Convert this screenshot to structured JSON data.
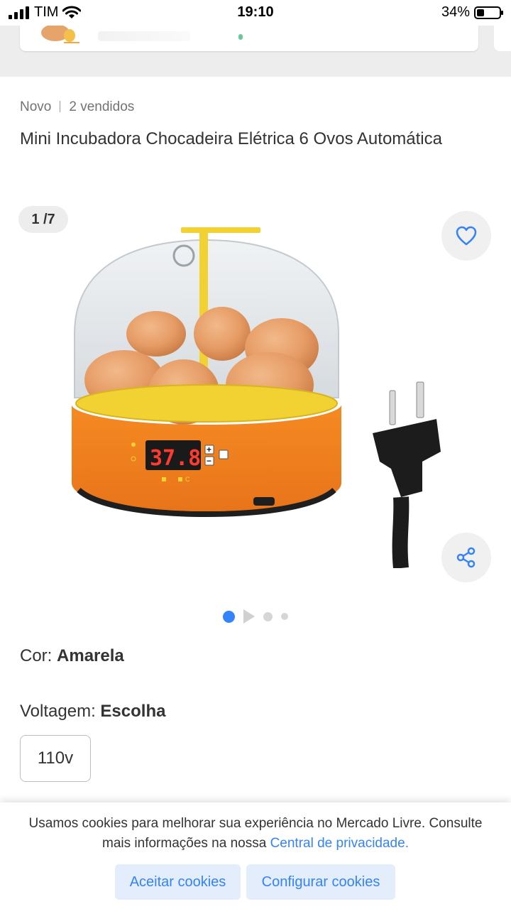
{
  "status_bar": {
    "carrier": "TIM",
    "time": "19:10",
    "battery_text": "34%",
    "battery_level": 0.34,
    "icons": [
      "signal-icon",
      "wifi-icon",
      "battery-icon"
    ]
  },
  "listing": {
    "condition": "Novo",
    "sold": "2 vendidos",
    "title": "Mini Incubadora Chocadeira Elétrica 6 Ovos Automática"
  },
  "gallery": {
    "counter": "1 /7",
    "display_temp": "37.8",
    "display_unit_c": "C",
    "current_index": 1,
    "total_images": 7,
    "icons": [
      "heart-icon",
      "share-icon",
      "play-icon"
    ]
  },
  "variations": {
    "color_label": "Cor: ",
    "color_value": "Amarela",
    "voltage_label": "Voltagem: ",
    "voltage_value": "Escolha",
    "voltage_option": "110v"
  },
  "cookies": {
    "text": "Usamos cookies para melhorar sua experiência no Mercado Livre. Consulte mais informações na nossa ",
    "link": "Central de privacidade.",
    "accept_label": "Aceitar cookies",
    "configure_label": "Configurar cookies"
  },
  "colors": {
    "accent": "#3483fa",
    "accent_bg": "#e3edfb",
    "text": "#333333",
    "muted": "#737373"
  }
}
